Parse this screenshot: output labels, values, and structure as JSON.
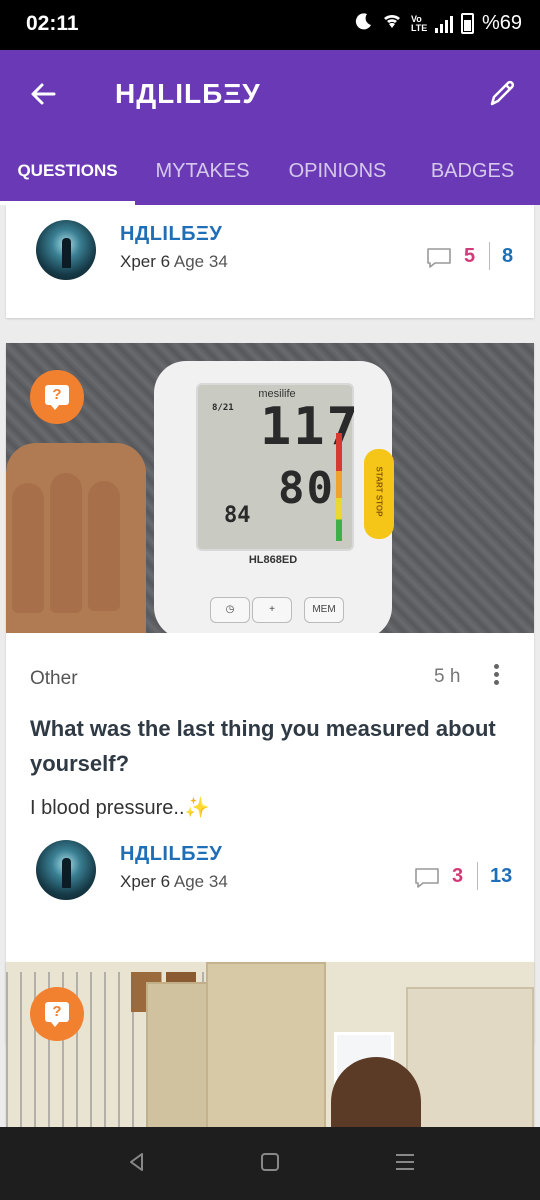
{
  "status_bar": {
    "time": "02:11",
    "network_label": "Vo LTE",
    "battery": "%69",
    "icons": [
      "moon-icon",
      "wifi-icon",
      "signal-icon",
      "battery-icon"
    ]
  },
  "app_bar": {
    "title": "НДLILБΞУ",
    "back_icon": "arrow-left-icon",
    "edit_icon": "pencil-icon",
    "background_color": "#6a3ab6"
  },
  "tabs": [
    {
      "label": "QUESTIONS",
      "active": true
    },
    {
      "label": "MYTAKES",
      "active": false
    },
    {
      "label": "OPINIONS",
      "active": false
    },
    {
      "label": "BADGES",
      "active": false
    }
  ],
  "cards": [
    {
      "author": {
        "name": "НДLILБΞУ",
        "xper_label": "Xper 6",
        "age": "Age 34"
      },
      "counts": {
        "opinions": "5",
        "views": "8"
      }
    },
    {
      "badge_icon": "question-bubble-icon",
      "photo": {
        "brand": "mesilife",
        "model": "HL868ED",
        "sys": "117",
        "dia": "80",
        "pulse": "84",
        "date": "8/21",
        "buttons": [
          "◷",
          "+",
          "MEM"
        ],
        "start_label": "START STOP"
      },
      "category": "Other",
      "time_ago": "5 h",
      "title": "What was the last thing you measured about yourself?",
      "description": "I blood pressure..✨",
      "author": {
        "name": "НДLILБΞУ",
        "xper_label": "Xper 6",
        "age": "Age 34"
      },
      "counts": {
        "opinions": "3",
        "views": "13"
      }
    },
    {
      "badge_icon": "question-bubble-icon"
    }
  ],
  "colors": {
    "accent_purple": "#6a3ab6",
    "author_blue": "#1f6fb8",
    "count_pink": "#d43a79",
    "badge_orange": "#f1802f"
  },
  "nav_bar": {
    "icons": [
      "back-triangle-icon",
      "home-square-icon",
      "recents-menu-icon"
    ]
  }
}
